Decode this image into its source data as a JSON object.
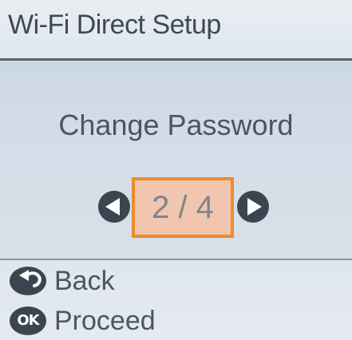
{
  "header": {
    "title": "Wi-Fi Direct Setup"
  },
  "main": {
    "heading": "Change Password",
    "pager": {
      "label": "2 / 4",
      "current": 2,
      "total": 4,
      "prev_icon": "left-arrow-icon",
      "next_icon": "right-arrow-icon"
    }
  },
  "footer": {
    "back": {
      "icon": "back-icon",
      "label": "Back"
    },
    "proceed": {
      "icon": "ok-button-icon",
      "icon_text": "OK",
      "label": "Proceed"
    }
  },
  "colors": {
    "highlight_border": "#f08a2a",
    "highlight_fill": "#f0c6b0",
    "icon_dark": "#3b4550",
    "background": "#cdd8e3"
  }
}
